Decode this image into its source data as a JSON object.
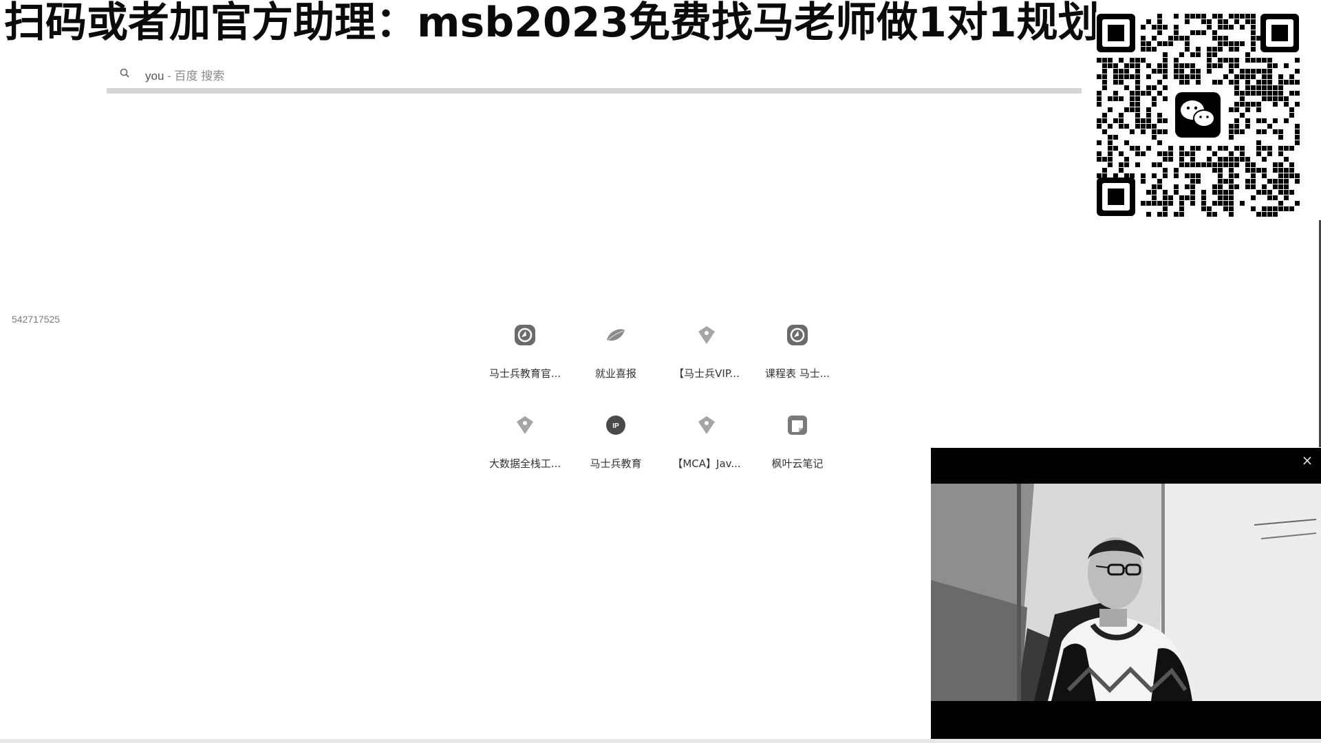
{
  "banner": {
    "text": "扫码或者加官方助理：msb2023免费找马老师做1对1规划"
  },
  "qr": {
    "icon": "wechat-qr-code"
  },
  "search": {
    "query": "you",
    "hint": " - 百度 搜索",
    "icon": "search-icon"
  },
  "side": {
    "id_text": "542717525"
  },
  "shortcuts": [
    {
      "label": "马士兵教育官...",
      "icon": "site-icon"
    },
    {
      "label": "就业喜报",
      "icon": "leaf-icon"
    },
    {
      "label": "【马士兵VIP...",
      "icon": "diamond-icon"
    },
    {
      "label": "课程表 马士...",
      "icon": "site-icon"
    },
    {
      "label": "大数据全栈工...",
      "icon": "diamond-icon"
    },
    {
      "label": "马士兵教育",
      "icon": "ip-icon"
    },
    {
      "label": "【MCA】Jav...",
      "icon": "diamond-icon"
    },
    {
      "label": "枫叶云笔记",
      "icon": "note-icon"
    }
  ],
  "video": {
    "close_label": "×"
  }
}
